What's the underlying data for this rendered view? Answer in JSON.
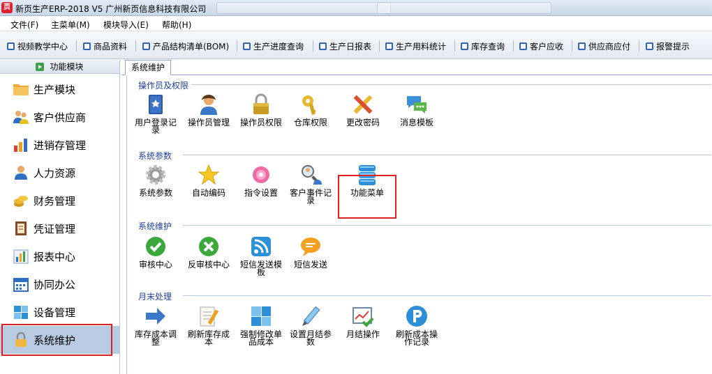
{
  "window": {
    "title": "新页生产ERP-2018 V5 广州新页信息科技有限公司",
    "logo": "页"
  },
  "menu": [
    "文件(F)",
    "主菜单(M)",
    "模块导入(E)",
    "帮助(H)"
  ],
  "toolbar": [
    "视频教学中心",
    "商品资料",
    "产品结构清单(BOM)",
    "生产进度查询",
    "生产日报表",
    "生产用料统计",
    "库存查询",
    "客户应收",
    "供应商应付",
    "报警提示"
  ],
  "sidebar": {
    "header": "功能模块",
    "items": [
      {
        "label": "生产模块",
        "icon": "folder-icon"
      },
      {
        "label": "客户供应商",
        "icon": "people-icon"
      },
      {
        "label": "进销存管理",
        "icon": "bar-chart-icon"
      },
      {
        "label": "人力资源",
        "icon": "person-icon"
      },
      {
        "label": "财务管理",
        "icon": "coins-icon"
      },
      {
        "label": "凭证管理",
        "icon": "ledger-icon"
      },
      {
        "label": "报表中心",
        "icon": "report-icon"
      },
      {
        "label": "协同办公",
        "icon": "calendar-icon"
      },
      {
        "label": "设备管理",
        "icon": "tiles-icon"
      },
      {
        "label": "系统维护",
        "icon": "lock-icon"
      }
    ],
    "selected": "系统维护"
  },
  "tab": {
    "label": "系统维护"
  },
  "groups": [
    {
      "title": "操作员及权限",
      "items": [
        "用户登录记录",
        "操作员管理",
        "操作员权限",
        "仓库权限",
        "更改密码",
        "消息模板"
      ]
    },
    {
      "title": "系统参数",
      "items": [
        "系统参数",
        "自动编码",
        "指令设置",
        "客户事件记录",
        "功能菜单"
      ]
    },
    {
      "title": "系统维护",
      "items": [
        "审核中心",
        "反审核中心",
        "短信发送模板",
        "短信发送"
      ]
    },
    {
      "title": "月末处理",
      "items": [
        "库存成本调整",
        "刷新库存成本",
        "强制修改单品成本",
        "设置月结参数",
        "月结操作",
        "刷新成本操作记录"
      ]
    }
  ],
  "colors": {
    "accent": "#1c3f9e",
    "highlight": "#e02020",
    "selected": "#b9cbe3"
  }
}
